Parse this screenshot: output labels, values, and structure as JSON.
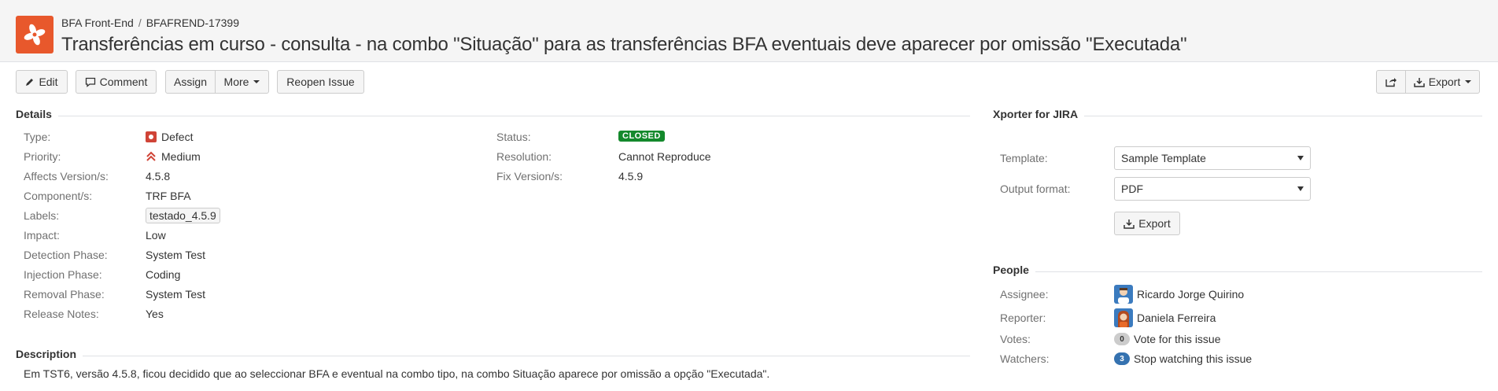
{
  "header": {
    "project_name": "BFA Front-End",
    "separator": "/",
    "issue_key": "BFAFREND-17399",
    "title": "Transferências em curso - consulta - na combo \"Situação\" para as transferências BFA eventuais deve aparecer por omissão \"Executada\"",
    "project_avatar_color": "#e8582c"
  },
  "toolbar": {
    "edit_label": "Edit",
    "comment_label": "Comment",
    "assign_label": "Assign",
    "more_label": "More",
    "reopen_label": "Reopen Issue",
    "share_icon": "share-icon",
    "export_label": "Export"
  },
  "details": {
    "title": "Details",
    "left": [
      {
        "label": "Type:",
        "value": "Defect",
        "icon": "defect-icon"
      },
      {
        "label": "Priority:",
        "value": "Medium",
        "icon": "priority-medium-icon"
      },
      {
        "label": "Affects Version/s:",
        "value": "4.5.8"
      },
      {
        "label": "Component/s:",
        "value": "TRF BFA"
      },
      {
        "label": "Labels:",
        "value": "testado_4.5.9"
      },
      {
        "label": "Impact:",
        "value": "Low"
      },
      {
        "label": "Detection Phase:",
        "value": "System Test"
      },
      {
        "label": "Injection Phase:",
        "value": "Coding"
      },
      {
        "label": "Removal Phase:",
        "value": "System Test"
      },
      {
        "label": "Release Notes:",
        "value": "Yes"
      }
    ],
    "right": [
      {
        "label": "Status:",
        "value": "CLOSED",
        "color": "#14892c"
      },
      {
        "label": "Resolution:",
        "value": "Cannot Reproduce"
      },
      {
        "label": "Fix Version/s:",
        "value": "4.5.9"
      }
    ]
  },
  "description": {
    "title": "Description",
    "text": "Em TST6, versão 4.5.8, ficou decidido que ao seleccionar BFA e eventual na combo tipo, na combo Situação aparece por omissão a opção \"Executada\"."
  },
  "xporter": {
    "title": "Xporter for JIRA",
    "template_label": "Template:",
    "template_value": "Sample Template",
    "output_label": "Output format:",
    "output_value": "PDF",
    "export_button": "Export"
  },
  "people": {
    "title": "People",
    "assignee_label": "Assignee:",
    "assignee_name": "Ricardo Jorge Quirino",
    "reporter_label": "Reporter:",
    "reporter_name": "Daniela Ferreira",
    "votes_label": "Votes:",
    "votes_count": "0",
    "votes_link": "Vote for this issue",
    "watchers_label": "Watchers:",
    "watchers_count": "3",
    "watchers_link": "Stop watching this issue"
  }
}
